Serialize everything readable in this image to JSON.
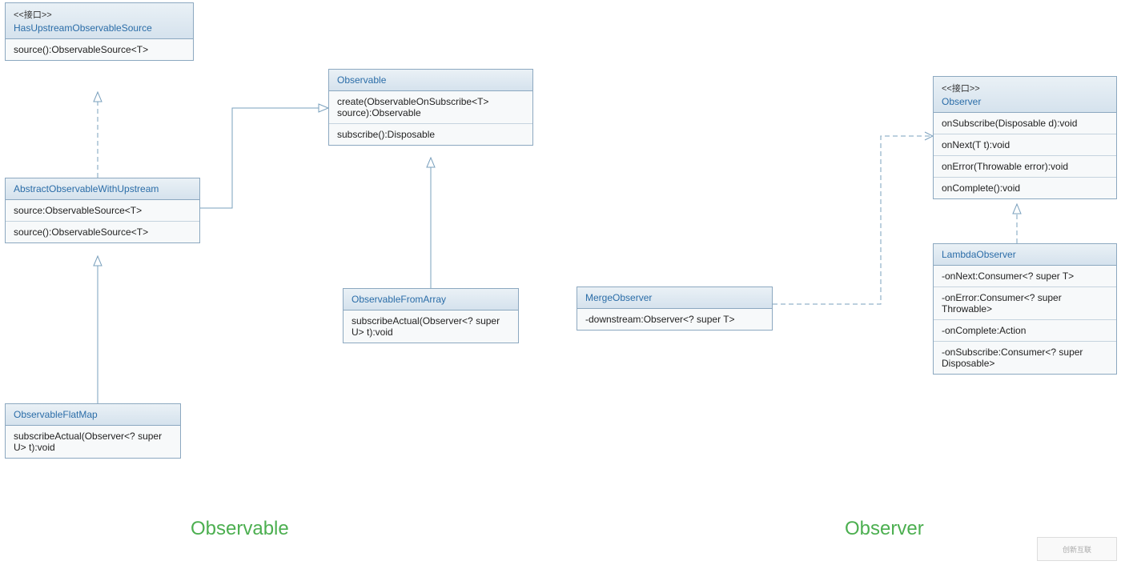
{
  "classes": {
    "hasUpstream": {
      "stereotype": "<<接口>>",
      "title": "HasUpstreamObservableSource",
      "method1": "source():ObservableSource<T>"
    },
    "observable": {
      "title": "Observable",
      "method1": "create(ObservableOnSubscribe<T> source):Observable",
      "method2": "subscribe():Disposable"
    },
    "abstractUpstream": {
      "title": "AbstractObservableWithUpstream",
      "field1": "source:ObservableSource<T>",
      "method1": "source():ObservableSource<T>"
    },
    "observableFromArray": {
      "title": "ObservableFromArray",
      "method1": "subscribeActual(Observer<? super U> t):void"
    },
    "observableFlatMap": {
      "title": "ObservableFlatMap",
      "method1": "subscribeActual(Observer<? super U> t):void"
    },
    "mergeObserver": {
      "title": "MergeObserver",
      "field1": "-downstream:Observer<? super T>"
    },
    "observer": {
      "stereotype": "<<接口>>",
      "title": "Observer",
      "method1": "onSubscribe(Disposable d):void",
      "method2": "onNext(T t):void",
      "method3": "onError(Throwable error):void",
      "method4": "onComplete():void"
    },
    "lambdaObserver": {
      "title": "LambdaObserver",
      "field1": "-onNext:Consumer<? super T>",
      "field2": "-onError:Consumer<? super Throwable>",
      "field3": "-onComplete:Action",
      "field4": "-onSubscribe:Consumer<? super Disposable>"
    }
  },
  "labels": {
    "observableSection": "Observable",
    "observerSection": "Observer"
  },
  "logo": "创新互联"
}
